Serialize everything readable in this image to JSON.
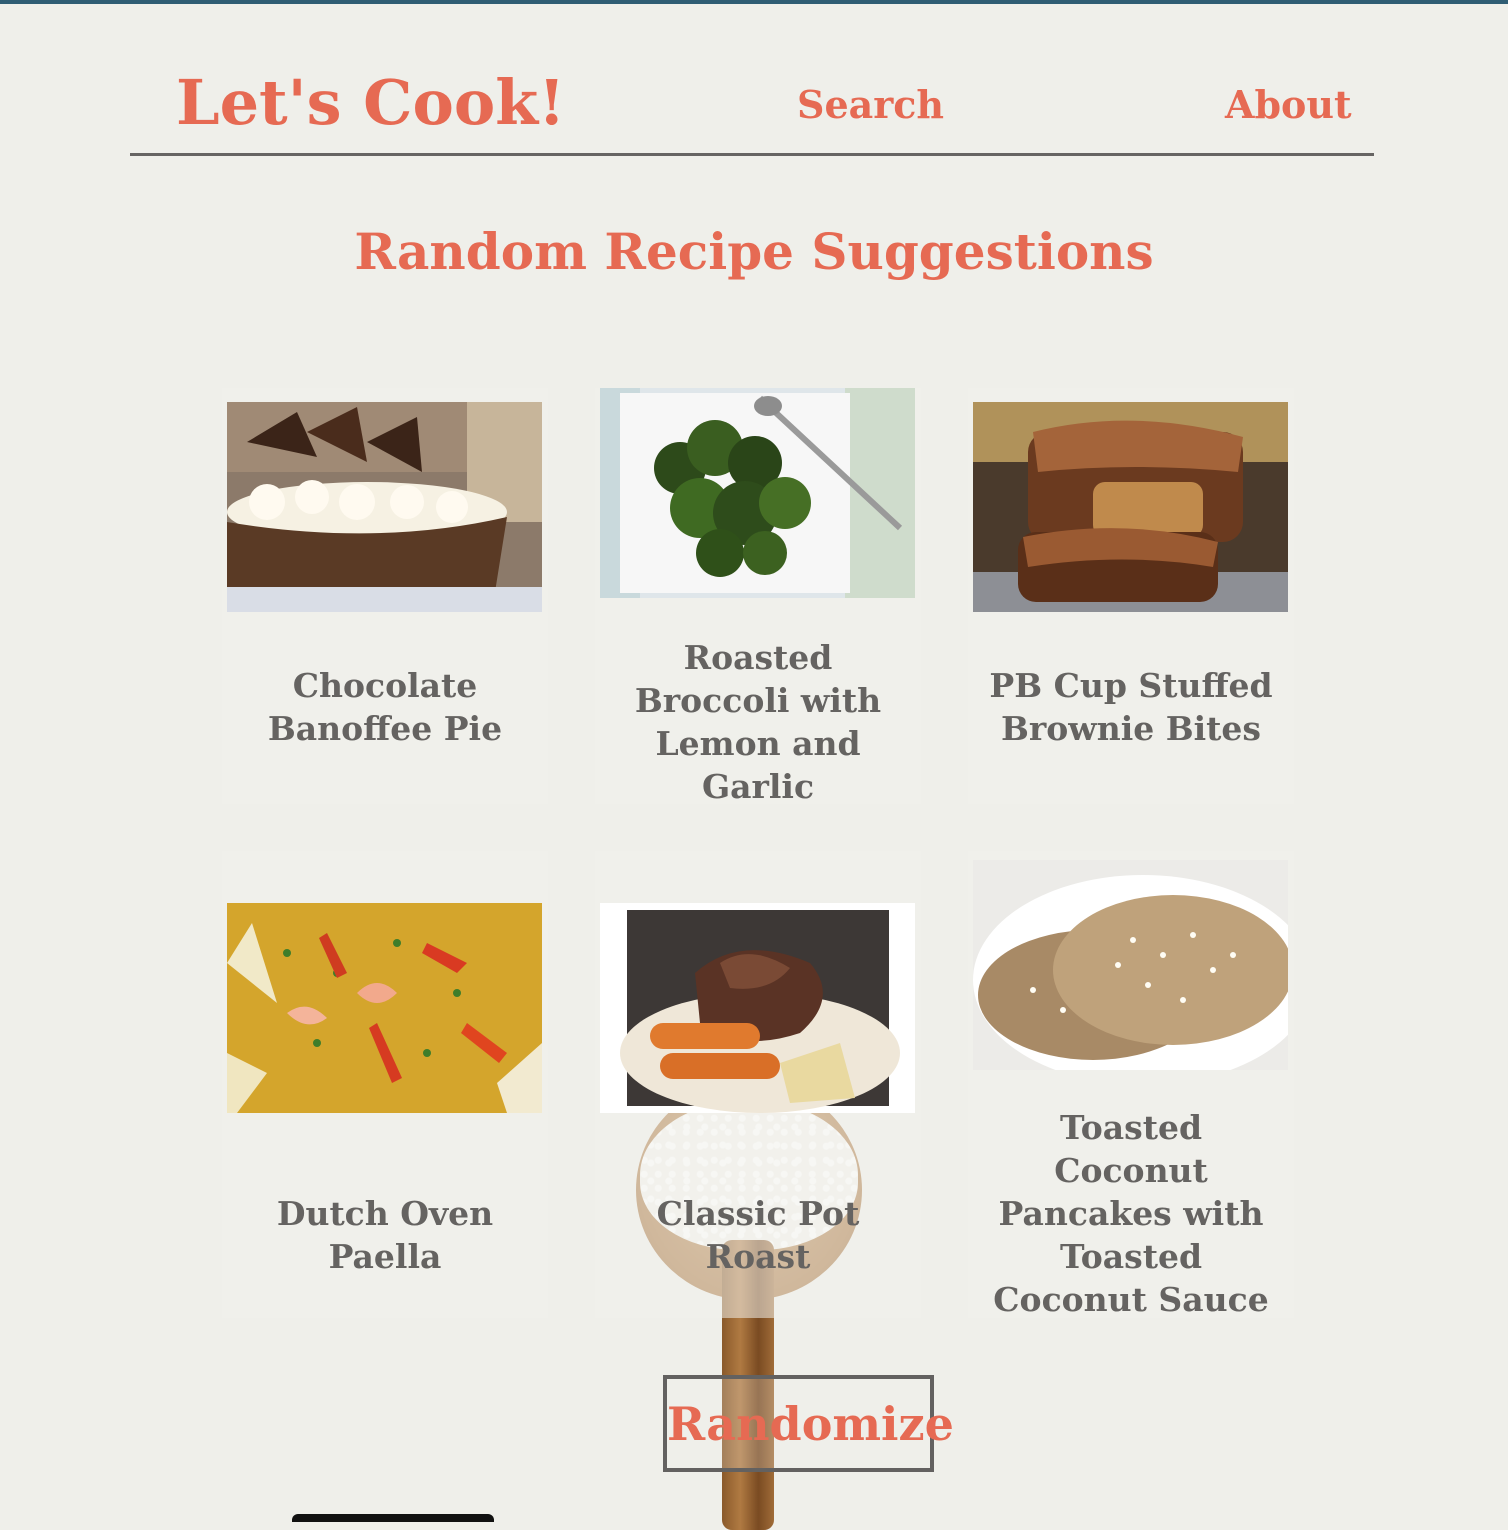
{
  "header": {
    "brand": "Let's Cook!",
    "nav": [
      {
        "label": "Search"
      },
      {
        "label": "About"
      }
    ]
  },
  "main": {
    "title": "Random Recipe Suggestions",
    "recipes": [
      {
        "title": "Chocolate Banoffee Pie"
      },
      {
        "title": "Roasted Broccoli with Lemon and Garlic"
      },
      {
        "title": "PB Cup Stuffed Brownie Bites"
      },
      {
        "title": "Dutch Oven Paella"
      },
      {
        "title": "Classic Pot Roast"
      },
      {
        "title": "Toasted Coconut Pancakes with Toasted Coconut Sauce"
      }
    ],
    "randomize_label": "Randomize"
  }
}
